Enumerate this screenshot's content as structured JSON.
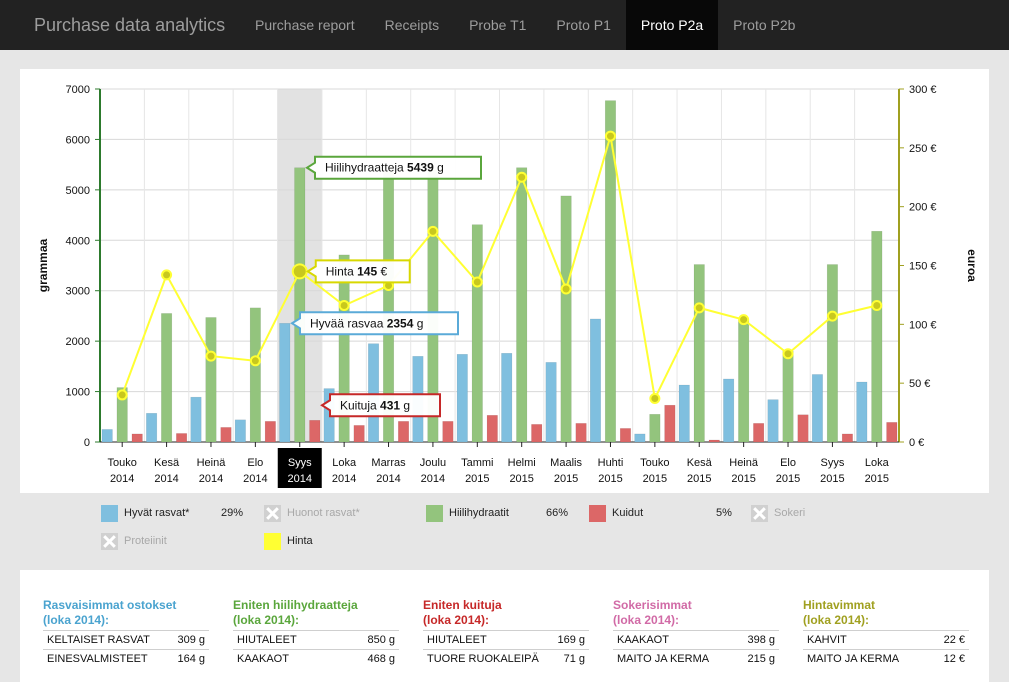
{
  "app": {
    "title": "Purchase data analytics",
    "tabs": [
      {
        "label": "Purchase report",
        "active": false
      },
      {
        "label": "Receipts",
        "active": false
      },
      {
        "label": "Probe T1",
        "active": false
      },
      {
        "label": "Proto P1",
        "active": false
      },
      {
        "label": "Proto P2a",
        "active": true
      },
      {
        "label": "Proto P2b",
        "active": false
      }
    ]
  },
  "chart_data": {
    "type": "bar",
    "x_labels": [
      [
        "Touko",
        "2014"
      ],
      [
        "Kesä",
        "2014"
      ],
      [
        "Heinä",
        "2014"
      ],
      [
        "Elo",
        "2014"
      ],
      [
        "Syys",
        "2014"
      ],
      [
        "Loka",
        "2014"
      ],
      [
        "Marras",
        "2014"
      ],
      [
        "Joulu",
        "2014"
      ],
      [
        "Tammi",
        "2015"
      ],
      [
        "Helmi",
        "2015"
      ],
      [
        "Maalis",
        "2015"
      ],
      [
        "Huhti",
        "2015"
      ],
      [
        "Touko",
        "2015"
      ],
      [
        "Kesä",
        "2015"
      ],
      [
        "Heinä",
        "2015"
      ],
      [
        "Elo",
        "2015"
      ],
      [
        "Syys",
        "2015"
      ],
      [
        "Loka",
        "2015"
      ]
    ],
    "selected_index": 4,
    "y_left_label": "grammaa",
    "y_left_ticks": [
      "0",
      "1000",
      "2000",
      "3000",
      "4000",
      "5000",
      "6000",
      "7000"
    ],
    "y_left_range": [
      0,
      7000
    ],
    "y_right_label": "euroa",
    "y_right_ticks": [
      "0 €",
      "50 €",
      "100 €",
      "150 €",
      "200 €",
      "250 €",
      "300 €"
    ],
    "y_right_range": [
      0,
      300
    ],
    "series": [
      {
        "name": "Hyvät rasvat*",
        "color": "#7fbfdf",
        "type": "bar",
        "values": [
          250,
          570,
          890,
          440,
          2354,
          1060,
          1950,
          1700,
          1740,
          1760,
          1580,
          2440,
          160,
          1130,
          1250,
          840,
          1340,
          1190
        ]
      },
      {
        "name": "Hiilihydraatit",
        "color": "#93c47d",
        "type": "bar",
        "values": [
          1080,
          2550,
          2470,
          2660,
          5439,
          3710,
          5360,
          5400,
          4310,
          5440,
          4880,
          6770,
          550,
          3520,
          2410,
          1800,
          3520,
          4180
        ]
      },
      {
        "name": "Kuidut",
        "color": "#dc6767",
        "type": "bar",
        "values": [
          160,
          170,
          290,
          410,
          431,
          330,
          410,
          410,
          530,
          350,
          370,
          270,
          730,
          40,
          370,
          540,
          160,
          390
        ]
      },
      {
        "name": "Hinta",
        "color": "#ffff33",
        "type": "line",
        "values": [
          40,
          142,
          73,
          69,
          145,
          116,
          133,
          179,
          136,
          225,
          130,
          260,
          37,
          114,
          104,
          75,
          107,
          116
        ]
      }
    ],
    "tooltips": [
      {
        "series": "Hiilihydraatit",
        "label": "Hiilihydraatteja",
        "value": "5439",
        "unit": "g"
      },
      {
        "series": "Hinta",
        "label": "Hinta",
        "value": "145",
        "unit": "€"
      },
      {
        "series": "Hyvät rasvat*",
        "label": "Hyvää rasvaa",
        "value": "2354",
        "unit": "g"
      },
      {
        "series": "Kuidut",
        "label": "Kuituja",
        "value": "431",
        "unit": "g"
      }
    ]
  },
  "legend": [
    {
      "label": "Hyvät rasvat*",
      "percent": "29%",
      "enabled": true,
      "color": "#7fbfdf"
    },
    {
      "label": "Huonot rasvat*",
      "percent": "",
      "enabled": false,
      "color": "#d0d0d0"
    },
    {
      "label": "Hiilihydraatit",
      "percent": "66%",
      "enabled": true,
      "color": "#93c47d"
    },
    {
      "label": "Kuidut",
      "percent": "5%",
      "enabled": true,
      "color": "#dc6767"
    },
    {
      "label": "Sokeri",
      "percent": "",
      "enabled": false,
      "color": "#d0d0d0"
    },
    {
      "label": "Proteiinit",
      "percent": "",
      "enabled": false,
      "color": "#d0d0d0"
    },
    {
      "label": "Hinta",
      "percent": "",
      "enabled": true,
      "color": "#ffff33"
    }
  ],
  "stats": [
    {
      "title": "Rasvaisimmat ostokset",
      "subtitle": "(loka 2014):",
      "color": "#4aa3cf",
      "rows": [
        [
          "KELTAISET RASVAT",
          "309 g"
        ],
        [
          "EINESVALMISTEET",
          "164 g"
        ]
      ]
    },
    {
      "title": "Eniten hiilihydraatteja",
      "subtitle": "(loka 2014):",
      "color": "#5aa63c",
      "rows": [
        [
          "HIUTALEET",
          "850 g"
        ],
        [
          "KAAKAOT",
          "468 g"
        ]
      ]
    },
    {
      "title": "Eniten kuituja",
      "subtitle": "(loka 2014):",
      "color": "#c62828",
      "rows": [
        [
          "HIUTALEET",
          "169 g"
        ],
        [
          "TUORE RUOKALEIPÄ",
          "71 g"
        ]
      ]
    },
    {
      "title": "Sokerisimmat",
      "subtitle": "(loka 2014):",
      "color": "#d16aa6",
      "rows": [
        [
          "KAAKAOT",
          "398 g"
        ],
        [
          "MAITO JA KERMA",
          "215 g"
        ]
      ]
    },
    {
      "title": "Hintavimmat",
      "subtitle": "(loka 2014):",
      "color": "#a0a020",
      "rows": [
        [
          "KAHVIT",
          "22 €"
        ],
        [
          "MAITO JA KERMA",
          "12 €"
        ]
      ]
    }
  ]
}
